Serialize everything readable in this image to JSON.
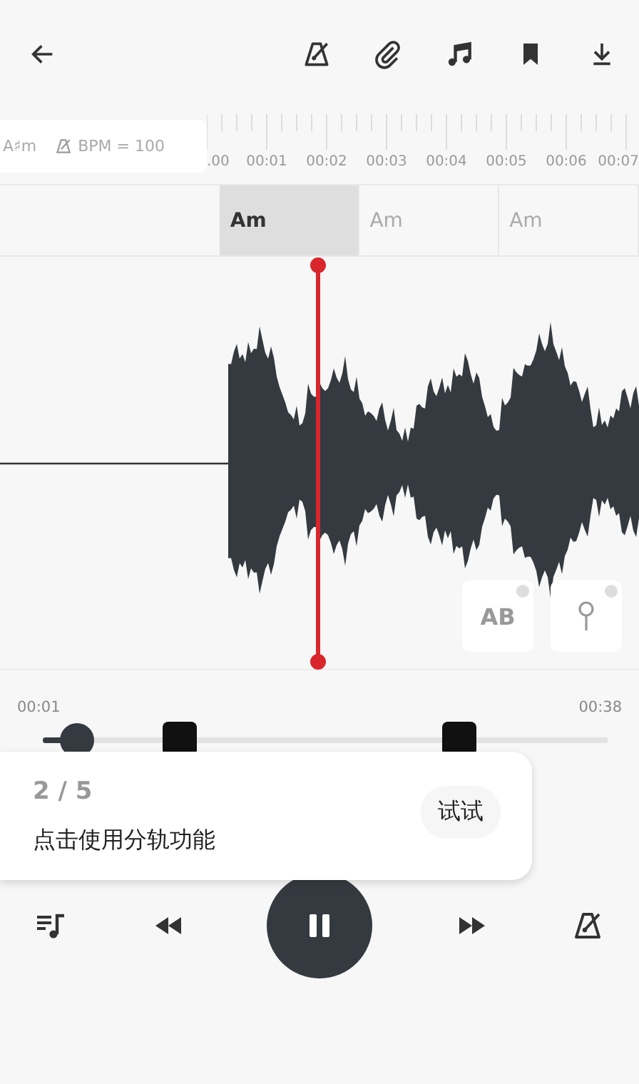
{
  "track_info": {
    "key": "A♯m",
    "bpm": "BPM = 100"
  },
  "timeline": [
    ".00",
    "00:01",
    "00:02",
    "00:03",
    "00:04",
    "00:05",
    "00:06",
    "00:07"
  ],
  "chords": [
    {
      "label": "Am",
      "selected": true
    },
    {
      "label": "Am",
      "selected": false
    },
    {
      "label": "Am",
      "selected": false
    }
  ],
  "markers": [
    "AB"
  ],
  "progress": {
    "current": "00:01",
    "total": "00:38",
    "level": 0.06
  },
  "tip": {
    "step": "2 / 5",
    "message": "点击使用分轨功能",
    "button": "试试"
  },
  "player": {
    "playing": true
  }
}
